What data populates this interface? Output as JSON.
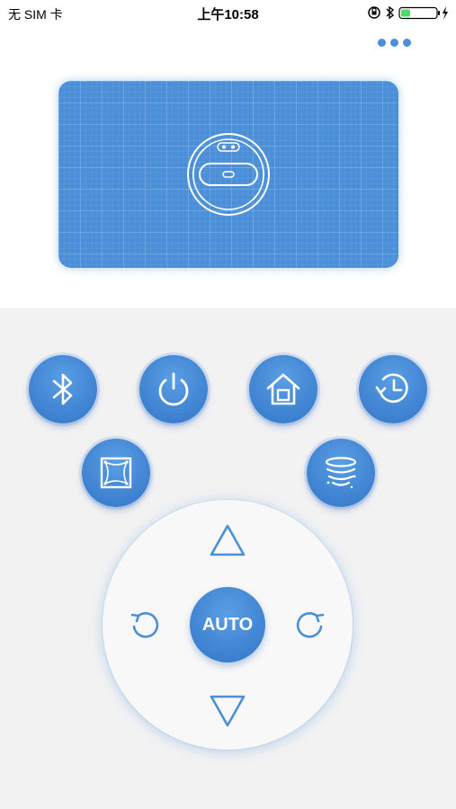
{
  "status_bar": {
    "carrier": "无 SIM 卡",
    "time": "上午10:58",
    "icons": [
      "orientation-lock-icon",
      "bluetooth-icon",
      "battery-icon",
      "charging-icon"
    ]
  },
  "header": {
    "more_icon": "more-dots-icon"
  },
  "map": {
    "icon": "robot-vacuum-icon",
    "accent": "#4a8fd8"
  },
  "controls": {
    "row1": [
      "bluetooth-icon",
      "power-icon",
      "home-icon",
      "history-icon"
    ],
    "row2": [
      "edge-clean-icon",
      "spot-clean-icon"
    ],
    "dpad": {
      "auto_label": "AUTO",
      "up_icon": "arrow-up-icon",
      "down_icon": "arrow-down-icon",
      "left_icon": "rotate-left-icon",
      "right_icon": "rotate-right-icon"
    }
  },
  "colors": {
    "accent": "#4a8fd8",
    "panel_bg": "#f2f2f3"
  }
}
